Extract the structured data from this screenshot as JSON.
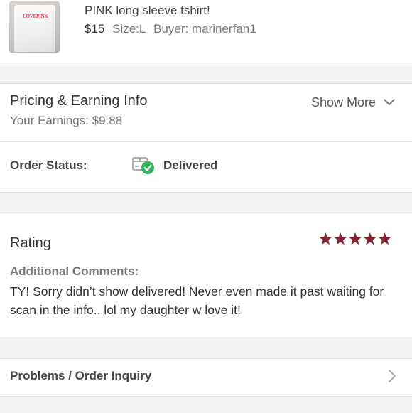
{
  "item": {
    "title": "PINK long sleeve tshirt!",
    "price": "$15",
    "size": "Size:L",
    "buyer": "Buyer: marinerfan1",
    "thumbnail_print": "LOVEPINK",
    "thumbnail_icon": "shirt-photo"
  },
  "pricing": {
    "title": "Pricing & Earning Info",
    "earnings": "Your Earnings: $9.88",
    "show_more_label": "Show More",
    "show_more_icon": "chevron-down-icon"
  },
  "order_status": {
    "label": "Order Status:",
    "value": "Delivered",
    "icon": "delivered-box-check-icon",
    "check_color": "#2eb35a"
  },
  "rating": {
    "title": "Rating",
    "stars": 5,
    "max_stars": 5,
    "star_color": "#822432",
    "comments_label": "Additional Comments:",
    "comments_text": "TY! Sorry didn’t show delivered! Never even made it past waiting for scan in the info.. lol my daughter w love it!"
  },
  "problems": {
    "label": "Problems / Order Inquiry",
    "icon": "chevron-right-icon"
  },
  "colors": {
    "section_gap": "#f4f4f4",
    "divider": "#dddddd",
    "text_primary": "#333333",
    "text_secondary": "#777777"
  }
}
